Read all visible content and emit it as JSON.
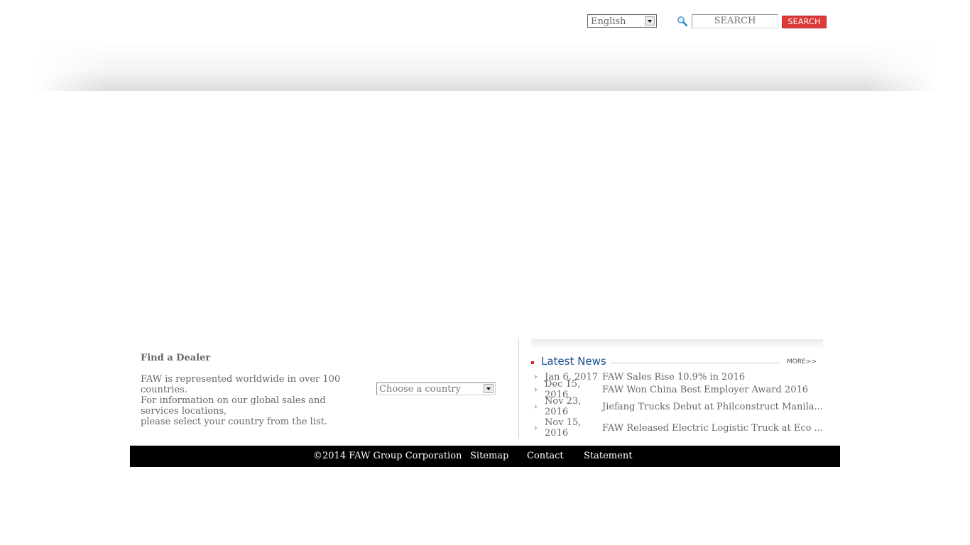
{
  "top_bar": {
    "language": {
      "selected": "English"
    },
    "search": {
      "placeholder": "SEARCH",
      "button_label": "SEARCH"
    }
  },
  "dealer": {
    "title": "Find a Dealer",
    "description_lines": [
      "FAW is represented worldwide in over 100 countries.",
      "For information on our global sales and services locations,",
      "please select your country from the list."
    ],
    "country_select": {
      "selected": "Choose a country"
    }
  },
  "news": {
    "title": "Latest News",
    "more_label": "MORE>>",
    "items": [
      {
        "date": "Jan 6, 2017",
        "headline": "FAW Sales Rise 10.9% in 2016"
      },
      {
        "date": "Dec 15, 2016",
        "headline": "FAW Won China Best Employer Award 2016"
      },
      {
        "date": "Nov 23, 2016",
        "headline": "Jiefang Trucks Debut at Philconstruct Manila..."
      },
      {
        "date": "Nov 15, 2016",
        "headline": "FAW Released Electric Logistic Truck at Eco ..."
      }
    ]
  },
  "footer": {
    "copyright": "©2014 FAW Group Corporation",
    "links": [
      "Sitemap",
      "Contact",
      "Statement"
    ]
  },
  "colors": {
    "search_button": "#dd3a3a",
    "news_title": "#1a4f8f",
    "news_bullet": "#e02020",
    "footer_bg": "#000000"
  }
}
